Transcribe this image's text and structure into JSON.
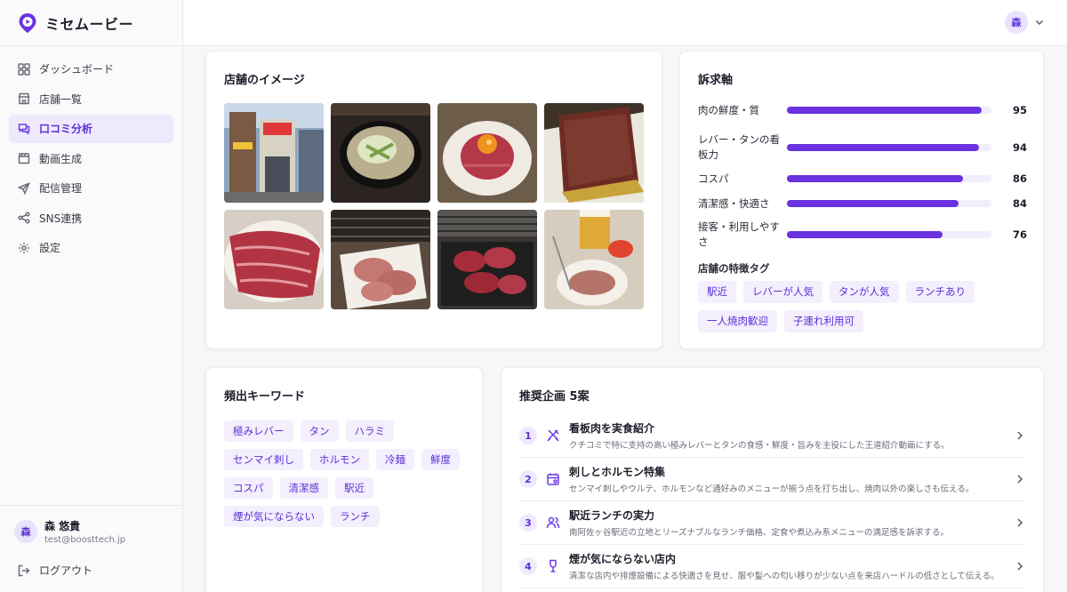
{
  "app": {
    "name": "ミセムービー",
    "logo_icon": "map-pin-play-icon",
    "accent": "#6a32e0"
  },
  "sidebar": {
    "items": [
      {
        "label": "ダッシュボード",
        "icon": "grid-icon",
        "active": false
      },
      {
        "label": "店舗一覧",
        "icon": "store-icon",
        "active": false
      },
      {
        "label": "口コミ分析",
        "icon": "chat-icon",
        "active": true
      },
      {
        "label": "動画生成",
        "icon": "clapper-icon",
        "active": false
      },
      {
        "label": "配信管理",
        "icon": "send-icon",
        "active": false
      },
      {
        "label": "SNS連携",
        "icon": "share-icon",
        "active": false
      },
      {
        "label": "設定",
        "icon": "gear-icon",
        "active": false
      }
    ],
    "user": {
      "avatar": "森",
      "name": "森 悠貴",
      "email": "test@boosttech.jp"
    },
    "logout_label": "ログアウト"
  },
  "topbar": {
    "avatar": "森"
  },
  "images_card": {
    "title": "店舗のイメージ",
    "photos": [
      "storefront",
      "soup-bowl",
      "yukhoe",
      "meat-block",
      "raw-beef",
      "tongue-plate",
      "grill-meat",
      "beer-table"
    ]
  },
  "appeal_card": {
    "title": "訴求軸",
    "axes": [
      {
        "label": "肉の鮮度・質",
        "value": 95
      },
      {
        "label": "レバー・タンの看板力",
        "value": 94
      },
      {
        "label": "コスパ",
        "value": 86
      },
      {
        "label": "清潔感・快適さ",
        "value": 84
      },
      {
        "label": "接客・利用しやすさ",
        "value": 76
      }
    ],
    "tags_title": "店舗の特徴タグ",
    "tags": [
      "駅近",
      "レバーが人気",
      "タンが人気",
      "ランチあり",
      "一人焼肉歓迎",
      "子連れ利用可"
    ]
  },
  "keywords_card": {
    "title": "頻出キーワード",
    "keywords": [
      "極みレバー",
      "タン",
      "ハラミ",
      "センマイ刺し",
      "ホルモン",
      "冷麺",
      "鮮度",
      "コスパ",
      "清潔感",
      "駅近",
      "煙が気にならない",
      "ランチ"
    ]
  },
  "plans_card": {
    "title": "推奨企画 5案",
    "plans": [
      {
        "num": "1",
        "icon": "utensils-icon",
        "title": "看板肉を実食紹介",
        "desc": "クチコミで特に支持の高い極みレバーとタンの食感・鮮度・旨みを主役にした王道紹介動画にする。"
      },
      {
        "num": "2",
        "icon": "calendar-icon",
        "title": "刺しとホルモン特集",
        "desc": "センマイ刺しやウルテ、ホルモンなど通好みのメニューが揃う点を打ち出し、焼肉以外の楽しさも伝える。"
      },
      {
        "num": "3",
        "icon": "users-icon",
        "title": "駅近ランチの実力",
        "desc": "南阿佐ヶ谷駅近の立地とリーズナブルなランチ価格、定食や煮込み系メニューの満足感を訴求する。"
      },
      {
        "num": "4",
        "icon": "wine-icon",
        "title": "煙が気にならない店内",
        "desc": "清潔な店内や排煙設備による快適さを見せ、服や髪への匂い移りが少ない点を来店ハードルの低さとして伝える。"
      }
    ]
  }
}
